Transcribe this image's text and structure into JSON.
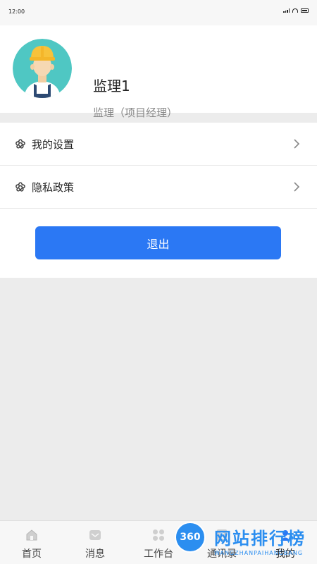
{
  "status_bar": {
    "time": "12:00"
  },
  "profile": {
    "name": "监理1",
    "role": "监理（项目经理）"
  },
  "menu": {
    "items": [
      {
        "label": "我的设置",
        "icon": "flower-settings-icon"
      },
      {
        "label": "隐私政策",
        "icon": "flower-settings-icon"
      }
    ]
  },
  "logout": {
    "label": "退出"
  },
  "tabbar": {
    "tabs": [
      {
        "label": "首页",
        "icon": "home-icon"
      },
      {
        "label": "消息",
        "icon": "message-icon"
      },
      {
        "label": "工作台",
        "icon": "grid-icon"
      },
      {
        "label": "通讯录",
        "icon": "contacts-icon"
      },
      {
        "label": "我的",
        "icon": "profile-icon"
      }
    ],
    "active": "我的"
  },
  "watermark": {
    "badge": "360",
    "title": "网站排行榜",
    "subtitle": "WANGZHANPAIHANGBANG"
  },
  "colors": {
    "primary": "#2b78f4",
    "background": "#ececec",
    "watermark": "#2b8ef0"
  }
}
